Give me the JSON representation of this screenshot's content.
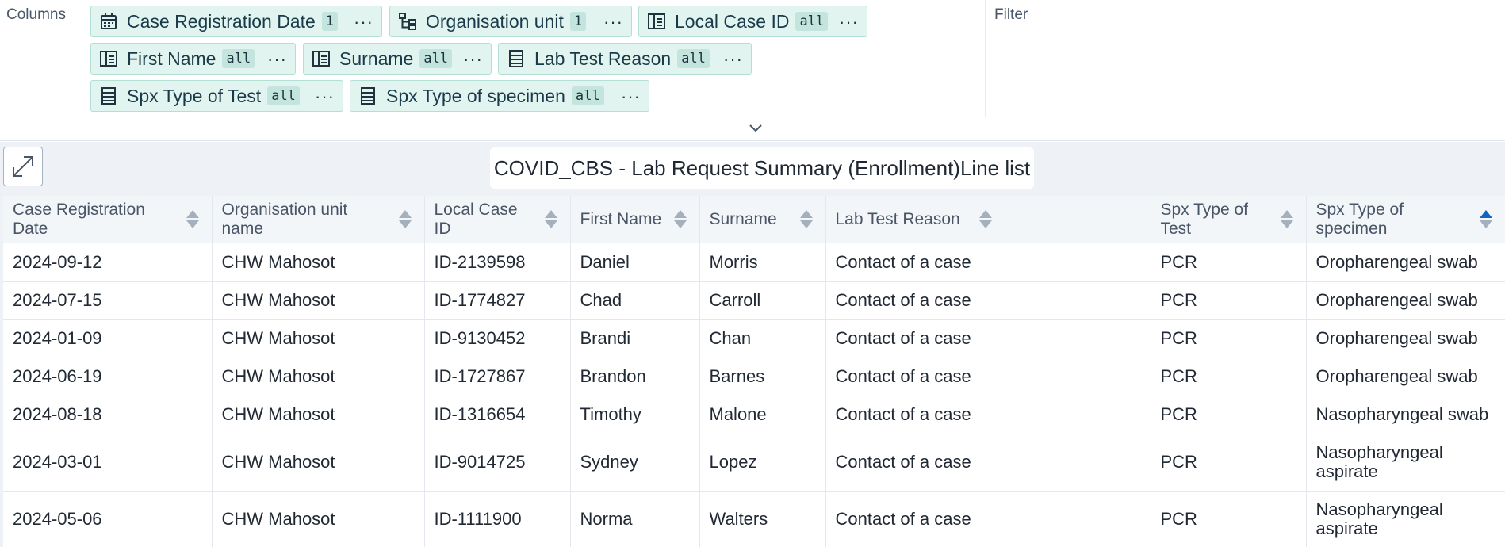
{
  "layout": {
    "columns_title": "Columns",
    "filter_title": "Filter",
    "chips": [
      {
        "label": "Case Registration Date",
        "badge": "1",
        "icon": "calendar-icon"
      },
      {
        "label": "Organisation unit",
        "badge": "1",
        "icon": "org-tree-icon"
      },
      {
        "label": "Local Case ID",
        "badge": "all",
        "icon": "data-element-icon"
      },
      {
        "label": "First Name",
        "badge": "all",
        "icon": "data-element-icon"
      },
      {
        "label": "Surname",
        "badge": "all",
        "icon": "data-element-icon"
      },
      {
        "label": "Lab Test Reason",
        "badge": "all",
        "icon": "option-set-icon"
      },
      {
        "label": "Spx Type of Test",
        "badge": "all",
        "icon": "option-set-icon"
      },
      {
        "label": "Spx Type of specimen",
        "badge": "all",
        "icon": "option-set-icon"
      }
    ],
    "chip_menu": "···"
  },
  "visualization": {
    "title": "COVID_CBS - Lab Request Summary (Enrollment)Line list"
  },
  "table": {
    "headers": [
      "Case Registration Date",
      "Organisation unit name",
      "Local Case ID",
      "First Name",
      "Surname",
      "Lab Test Reason",
      "Spx Type of Test",
      "Spx Type of specimen"
    ],
    "sorted_column": "Spx Type of specimen",
    "sort_direction": "ascending",
    "rows": [
      [
        "2024-09-12",
        "CHW Mahosot",
        "ID-2139598",
        "Daniel",
        "Morris",
        "Contact of a case",
        "PCR",
        "Oropharengeal swab"
      ],
      [
        "2024-07-15",
        "CHW Mahosot",
        "ID-1774827",
        "Chad",
        "Carroll",
        "Contact of a case",
        "PCR",
        "Oropharengeal swab"
      ],
      [
        "2024-01-09",
        "CHW Mahosot",
        "ID-9130452",
        "Brandi",
        "Chan",
        "Contact of a case",
        "PCR",
        "Oropharengeal swab"
      ],
      [
        "2024-06-19",
        "CHW Mahosot",
        "ID-1727867",
        "Brandon",
        "Barnes",
        "Contact of a case",
        "PCR",
        "Oropharengeal swab"
      ],
      [
        "2024-08-18",
        "CHW Mahosot",
        "ID-1316654",
        "Timothy",
        "Malone",
        "Contact of a case",
        "PCR",
        "Nasopharyngeal swab"
      ],
      [
        "2024-03-01",
        "CHW Mahosot",
        "ID-9014725",
        "Sydney",
        "Lopez",
        "Contact of a case",
        "PCR",
        "Nasopharyngeal aspirate"
      ],
      [
        "2024-05-06",
        "CHW Mahosot",
        "ID-1111900",
        "Norma",
        "Walters",
        "Contact of a case",
        "PCR",
        "Nasopharyngeal aspirate"
      ]
    ]
  },
  "colors": {
    "chip_bg": "#e1f4ef",
    "chip_border": "#b3dfd5",
    "sort_active": "#1565c0",
    "header_bg": "#f3f6f9"
  }
}
